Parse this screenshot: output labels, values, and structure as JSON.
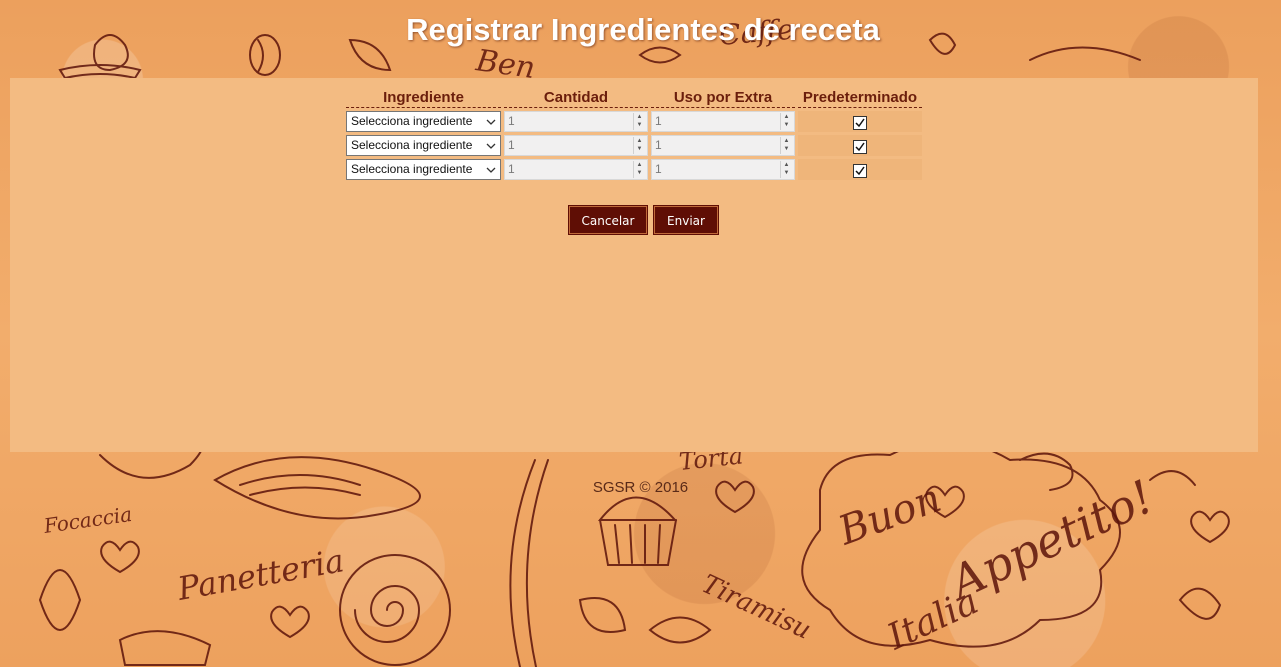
{
  "page": {
    "title": "Registrar Ingredientes de receta",
    "footer": "SGSR © 2016"
  },
  "table": {
    "headers": {
      "ingredient": "Ingrediente",
      "quantity": "Cantidad",
      "extra_use": "Uso por Extra",
      "default": "Predeterminado"
    },
    "rows": [
      {
        "ingredient": "Selecciona ingrediente",
        "quantity": "1",
        "extra_use": "1",
        "default_checked": true
      },
      {
        "ingredient": "Selecciona ingrediente",
        "quantity": "1",
        "extra_use": "1",
        "default_checked": true
      },
      {
        "ingredient": "Selecciona ingrediente",
        "quantity": "1",
        "extra_use": "1",
        "default_checked": true
      }
    ]
  },
  "actions": {
    "cancel_label": "Cancelar",
    "send_label": "Enviar"
  },
  "colors": {
    "background": "#efa460",
    "panel": "#f3bb82",
    "header_text": "#6b1e0c",
    "button": "#5f0e05",
    "title_text": "#ffffff"
  },
  "icons": {
    "select_arrow": "chevron-down-icon",
    "spinner": "stepper-arrows-icon",
    "checkbox": "checkmark-icon"
  }
}
